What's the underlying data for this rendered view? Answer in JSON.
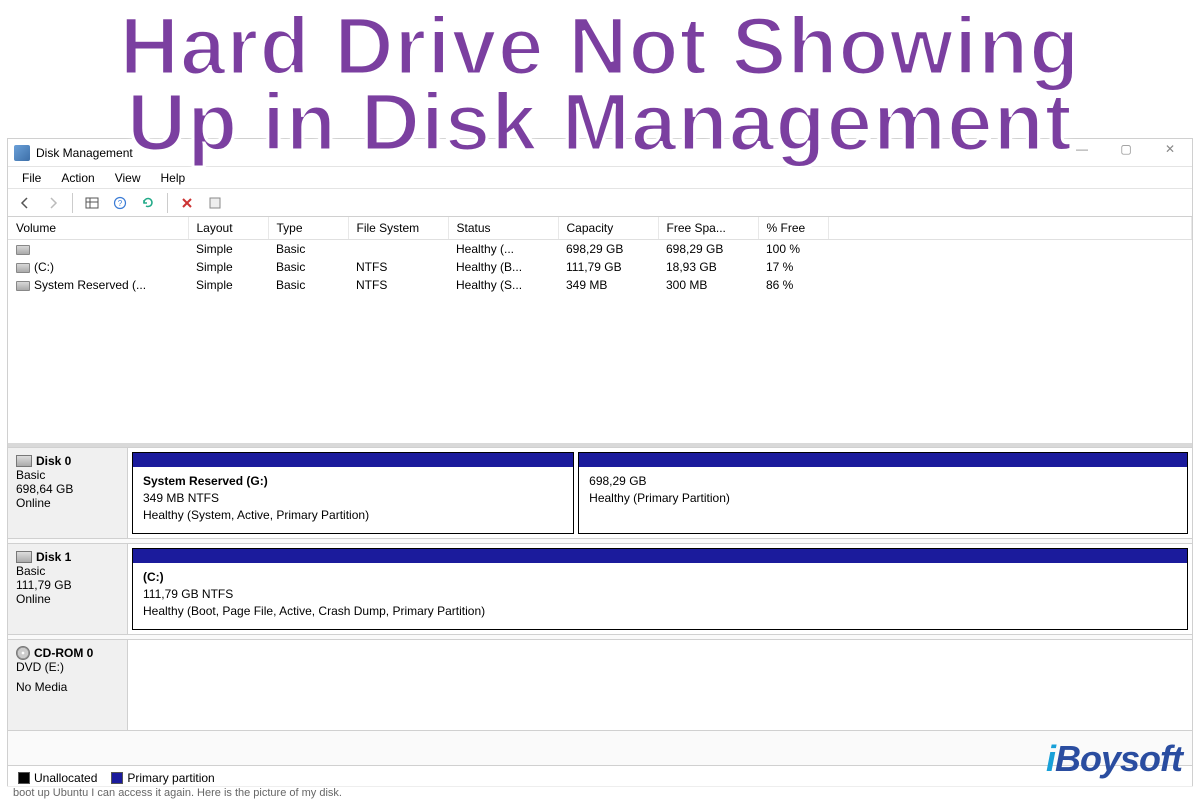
{
  "overlay": {
    "line1": "Hard Drive Not Showing",
    "line2": "Up in Disk Management"
  },
  "window_title": "Disk Management",
  "menubar": {
    "file": "File",
    "action": "Action",
    "view": "View",
    "help": "Help"
  },
  "columns": {
    "volume": "Volume",
    "layout": "Layout",
    "type": "Type",
    "filesystem": "File System",
    "status": "Status",
    "capacity": "Capacity",
    "free": "Free Spa...",
    "pctfree": "% Free"
  },
  "volumes": [
    {
      "name": "",
      "layout": "Simple",
      "type": "Basic",
      "fs": "",
      "status": "Healthy (...",
      "capacity": "698,29 GB",
      "free": "698,29 GB",
      "pct": "100 %"
    },
    {
      "name": "(C:)",
      "layout": "Simple",
      "type": "Basic",
      "fs": "NTFS",
      "status": "Healthy (B...",
      "capacity": "111,79 GB",
      "free": "18,93 GB",
      "pct": "17 %"
    },
    {
      "name": "System Reserved (...",
      "layout": "Simple",
      "type": "Basic",
      "fs": "NTFS",
      "status": "Healthy (S...",
      "capacity": "349 MB",
      "free": "300 MB",
      "pct": "86 %"
    }
  ],
  "disks": [
    {
      "name": "Disk 0",
      "type": "Basic",
      "size": "698,64 GB",
      "state": "Online",
      "icon": "hdd",
      "partitions": [
        {
          "title": "System Reserved  (G:)",
          "line2": "349 MB NTFS",
          "line3": "Healthy (System, Active, Primary Partition)",
          "flex": 42
        },
        {
          "title": "",
          "line2": "698,29 GB",
          "line3": "Healthy (Primary Partition)",
          "flex": 58
        }
      ]
    },
    {
      "name": "Disk 1",
      "type": "Basic",
      "size": "111,79 GB",
      "state": "Online",
      "icon": "hdd",
      "partitions": [
        {
          "title": "(C:)",
          "line2": "111,79 GB NTFS",
          "line3": "Healthy (Boot, Page File, Active, Crash Dump, Primary Partition)",
          "flex": 100
        }
      ]
    },
    {
      "name": "CD-ROM 0",
      "type": "DVD (E:)",
      "size": "",
      "state": "No Media",
      "icon": "cd",
      "partitions": []
    }
  ],
  "legend": {
    "unallocated": "Unallocated",
    "primary": "Primary partition"
  },
  "watermark": {
    "i": "i",
    "rest": "Boysoft"
  },
  "toolbar_icons": {
    "back": "back-icon",
    "forward": "forward-icon",
    "table": "table-icon",
    "help": "help-icon",
    "refresh": "refresh-icon",
    "delete": "delete-icon"
  },
  "partial_text": "boot up Ubuntu I can access it again. Here is the picture of my disk."
}
